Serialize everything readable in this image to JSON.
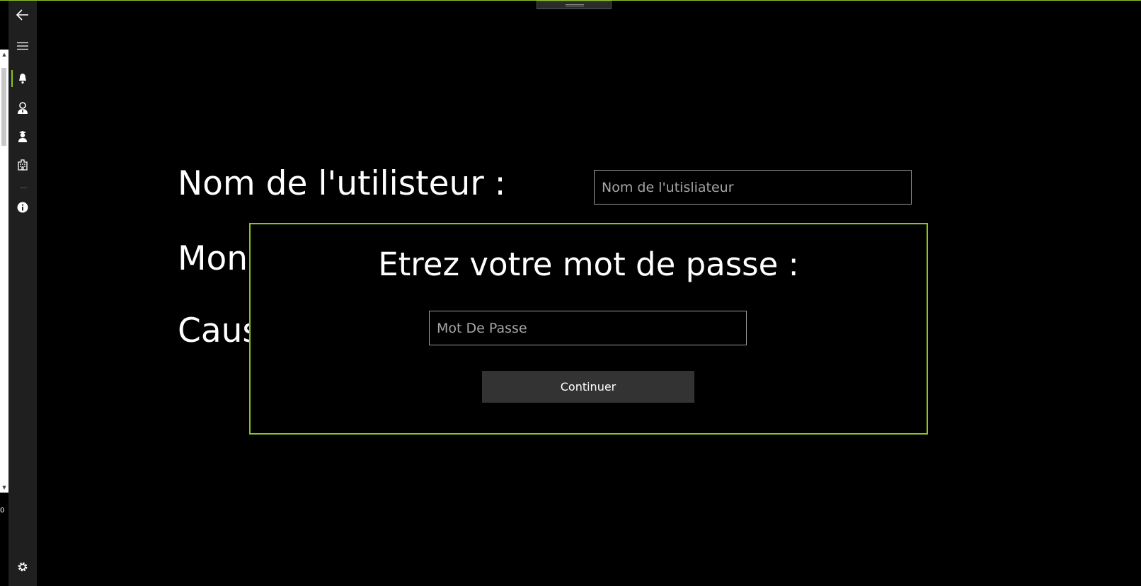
{
  "colors": {
    "accent": "#8dc21f",
    "background": "#000000",
    "nav_background": "#1f1f1f",
    "button_background": "#333333"
  },
  "nav": {
    "items": [
      {
        "icon": "back-arrow-icon"
      },
      {
        "icon": "hamburger-menu-icon"
      },
      {
        "icon": "bell-icon",
        "selected": true
      },
      {
        "icon": "user-tie-icon"
      },
      {
        "icon": "user-cap-icon"
      },
      {
        "icon": "building-icon"
      },
      {
        "icon": "info-icon"
      },
      {
        "icon": "gear-icon"
      }
    ]
  },
  "left_pane": {
    "value": "0"
  },
  "form": {
    "username_label": "Nom de l'utilisteur :",
    "username_placeholder": "Nom de l'utisliateur",
    "amount_label_visible": "Mon",
    "cause_label_visible": "Caus"
  },
  "modal": {
    "title": "Etrez votre mot de passe :",
    "password_placeholder": "Mot De Passe",
    "continue_label": "Continuer"
  }
}
